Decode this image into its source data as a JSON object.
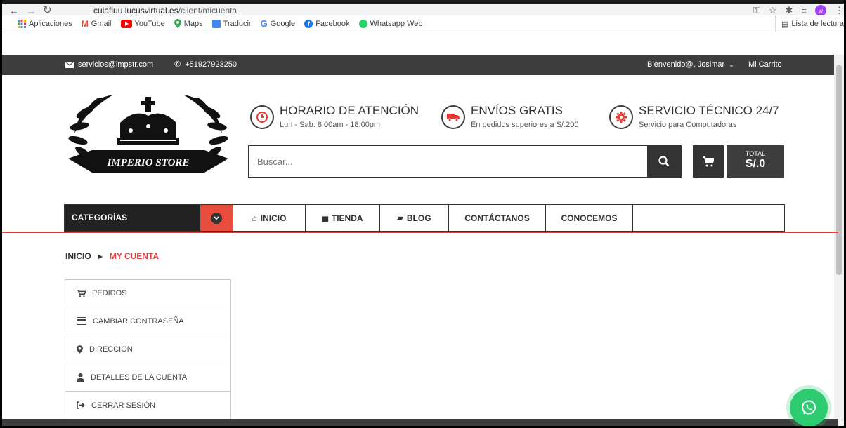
{
  "browser": {
    "url_host": "culafiuu.lucusvirtual.es",
    "url_path": "/client/micuenta",
    "profile_initial": "w",
    "bookmarks": [
      {
        "label": "Aplicaciones",
        "icon": "apps-grid-icon",
        "color": "#4285f4"
      },
      {
        "label": "Gmail",
        "icon": "gmail-icon",
        "color": "#ea4335"
      },
      {
        "label": "YouTube",
        "icon": "youtube-icon",
        "color": "#ff0000"
      },
      {
        "label": "Maps",
        "icon": "maps-pin-icon",
        "color": "#34a853"
      },
      {
        "label": "Traducir",
        "icon": "translate-icon",
        "color": "#4285f4"
      },
      {
        "label": "Google",
        "icon": "google-g-icon",
        "color": "#4285f4"
      },
      {
        "label": "Facebook",
        "icon": "facebook-icon",
        "color": "#1877f2"
      },
      {
        "label": "Whatsapp Web",
        "icon": "whatsapp-icon",
        "color": "#25d366"
      }
    ],
    "reading_list": "Lista de lectura"
  },
  "infobar": {
    "email": "servicios@impstr.com",
    "phone": "+51927923250",
    "welcome": "Bienvenido@, Josimar",
    "cart": "Mi Carrito"
  },
  "logo": {
    "text": "IMPERIO STORE"
  },
  "features": [
    {
      "title": "HORARIO DE ATENCIÓN",
      "subtitle": "Lun - Sab: 8:00am - 18:00pm",
      "icon": "clock-icon"
    },
    {
      "title": "ENVÍOS GRATIS",
      "subtitle": "En pedidos superiores a S/.200",
      "icon": "truck-icon"
    },
    {
      "title": "SERVICIO TÉCNICO 24/7",
      "subtitle": "Servicio para Computadoras",
      "icon": "gear-icon"
    }
  ],
  "search": {
    "placeholder": "Buscar..."
  },
  "total": {
    "label": "TOTAL",
    "value": "S/.0"
  },
  "menu": {
    "categories": "CATEGORÍAS",
    "items": [
      {
        "label": "INICIO",
        "icon": "home-icon"
      },
      {
        "label": "TIENDA",
        "icon": "shop-icon"
      },
      {
        "label": "BLOG",
        "icon": "book-icon"
      },
      {
        "label": "CONTÁCTANOS",
        "icon": ""
      },
      {
        "label": "CONOCEMOS",
        "icon": ""
      }
    ]
  },
  "breadcrumb": {
    "home": "INICIO",
    "current": "MY CUENTA"
  },
  "account_menu": [
    {
      "label": "PEDIDOS",
      "icon": "cart-icon"
    },
    {
      "label": "CAMBIAR CONTRASEÑA",
      "icon": "credit-card-icon"
    },
    {
      "label": "DIRECCIÓN",
      "icon": "map-marker-icon"
    },
    {
      "label": "DETALLES DE LA CUENTA",
      "icon": "user-icon"
    },
    {
      "label": "CERRAR SESIÓN",
      "icon": "sign-out-icon"
    }
  ],
  "colors": {
    "accent": "#e53935",
    "dark": "#3d3d3d",
    "whatsapp": "#2ecc71"
  }
}
